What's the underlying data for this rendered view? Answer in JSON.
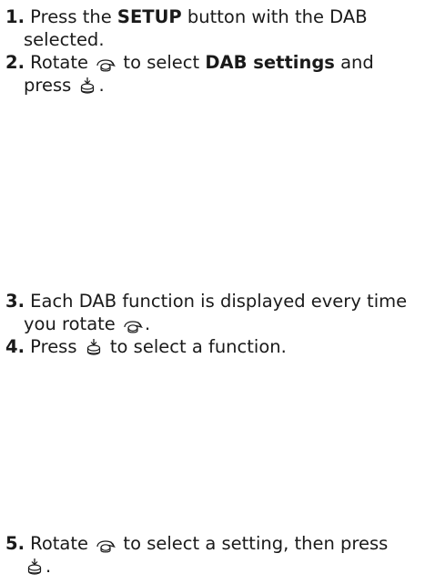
{
  "steps": [
    {
      "number": "1.",
      "t1": " Press the ",
      "b1": "SETUP",
      "t2": " button with the DAB",
      "t3": "selected."
    },
    {
      "number": "2.",
      "t1": " Rotate ",
      "t2": " to select ",
      "b1": "DAB settings",
      "t3": " and",
      "t4": "press ",
      "t5": "."
    },
    {
      "number": "3.",
      "t1": " Each DAB function is displayed every time",
      "t2": "you rotate ",
      "t3": "."
    },
    {
      "number": "4.",
      "t1": " Press ",
      "t2": " to select a function."
    },
    {
      "number": "5.",
      "t1": " Rotate ",
      "t2": " to select a setting, then press",
      "t3": "."
    }
  ],
  "icons": {
    "rotate": "rotary-knob-icon",
    "press": "press-button-icon"
  }
}
